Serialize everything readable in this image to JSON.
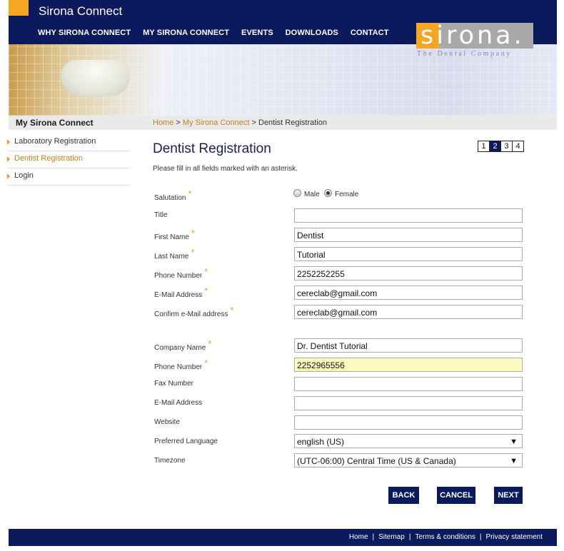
{
  "site": {
    "title": "Sirona Connect"
  },
  "nav": [
    "WHY SIRONA CONNECT",
    "MY SIRONA CONNECT",
    "EVENTS",
    "DOWNLOADS",
    "CONTACT"
  ],
  "logo": {
    "text": "sirona.",
    "tagline": "The Dental Company"
  },
  "sidebar": {
    "heading": "My Sirona Connect",
    "items": [
      {
        "label": "Laboratory Registration"
      },
      {
        "label": "Dentist Registration"
      },
      {
        "label": "Login"
      }
    ]
  },
  "breadcrumb": {
    "home": "Home",
    "sep1": ">",
    "section": "My Sirona Connect",
    "current": "> Dentist Registration"
  },
  "page": {
    "title": "Dentist Registration",
    "intro": "Please fill in all fields marked with an asterisk."
  },
  "steps": [
    "1",
    "2",
    "3",
    "4"
  ],
  "steps_current": "2",
  "form": {
    "salutation_label": "Salutation",
    "male_label": "Male",
    "female_label": "Female",
    "title_label": "Title",
    "title_value": "",
    "first_name_label": "First Name",
    "first_name_value": "Dentist",
    "last_name_label": "Last Name",
    "last_name_value": "Tutorial",
    "phone_label": "Phone Number",
    "phone_value": "2252252255",
    "email_label": "E-Mail Address",
    "email_value": "cereclab@gmail.com",
    "confirm_email_label": "Confirm e-Mail address",
    "confirm_email_value": "cereclab@gmail.com",
    "company_label": "Company Name",
    "company_value": "Dr. Dentist Tutorial",
    "company_phone_label": "Phone Number",
    "company_phone_value": "2252965556",
    "fax_label": "Fax Number",
    "fax_value": "",
    "company_email_label": "E-Mail Address",
    "company_email_value": "",
    "website_label": "Website",
    "website_value": "",
    "language_label": "Preferred Language",
    "language_value": "english (US)",
    "timezone_label": "Timezone",
    "timezone_value": "(UTC-06:00) Central Time (US & Canada)",
    "asterisk": "*"
  },
  "buttons": {
    "back": "BACK",
    "cancel": "CANCEL",
    "next": "NEXT"
  },
  "footer": {
    "home": "Home",
    "sitemap": "Sitemap",
    "terms": "Terms & conditions",
    "privacy": "Privacy statement",
    "sep": "|"
  },
  "colors": {
    "navy": "#0b1a5c",
    "orange": "#f5a623",
    "link": "#c87f1e",
    "highlight": "#fbfbc0"
  }
}
